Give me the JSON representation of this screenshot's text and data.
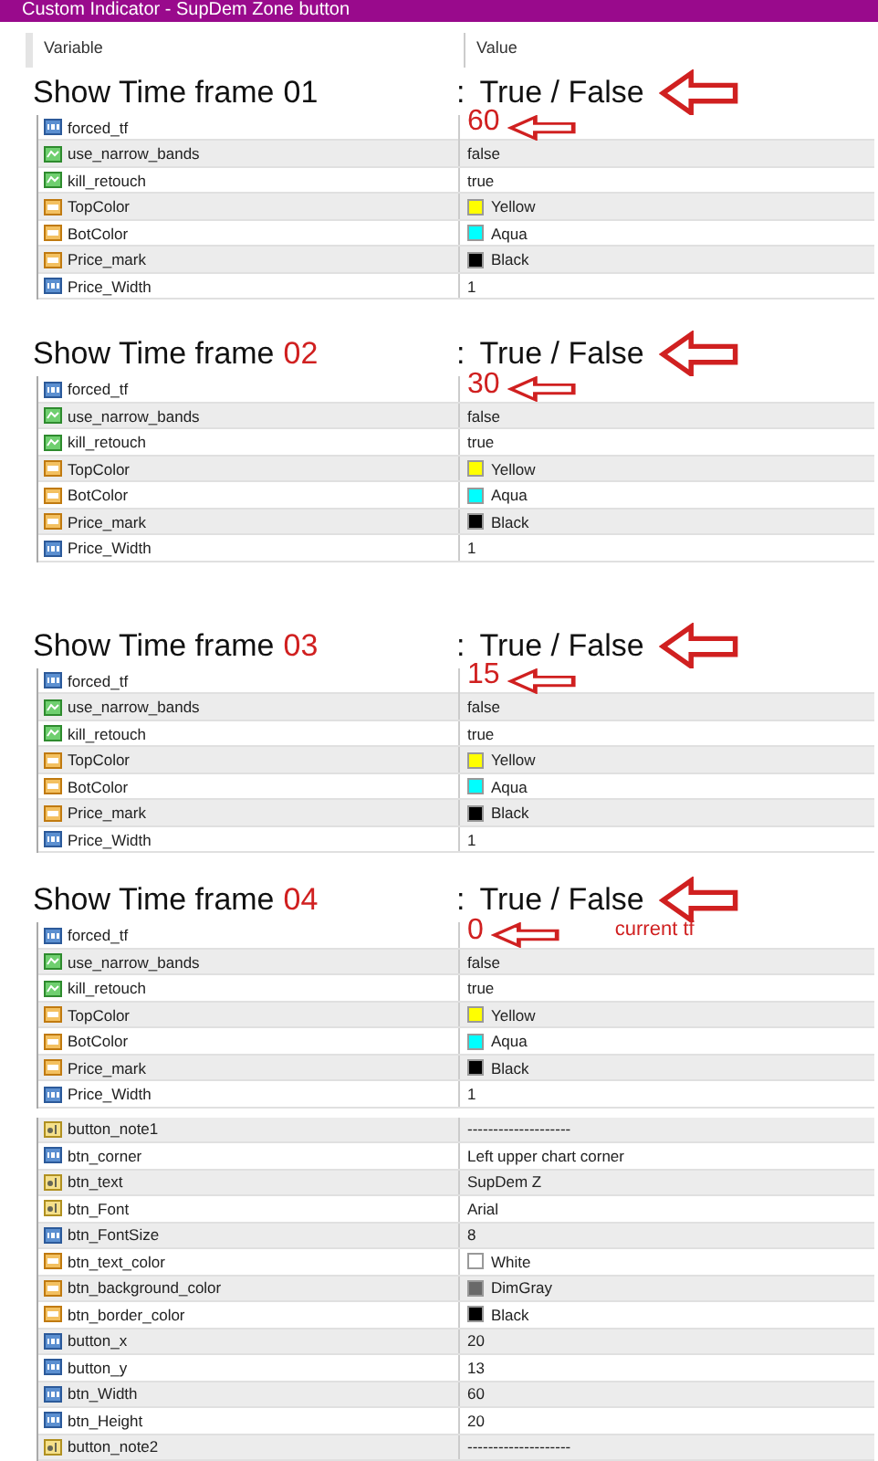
{
  "window": {
    "title": "Custom Indicator - SupDem Zone button"
  },
  "table": {
    "columns": [
      "Variable",
      "Value"
    ]
  },
  "sections": [
    {
      "heading": {
        "label": "Show Time frame",
        "number": "01",
        "number_red": false,
        "separator": ":",
        "value": "True / False"
      },
      "rows": [
        {
          "kind": "int",
          "name": "forced_tf",
          "value": "60",
          "annotated": true
        },
        {
          "kind": "bool",
          "name": "use_narrow_bands",
          "value": "false"
        },
        {
          "kind": "bool",
          "name": "kill_retouch",
          "value": "true"
        },
        {
          "kind": "color",
          "name": "TopColor",
          "value": "Yellow",
          "color": "#ffff00"
        },
        {
          "kind": "color",
          "name": "BotColor",
          "value": "Aqua",
          "color": "#00ffff"
        },
        {
          "kind": "color",
          "name": "Price_mark",
          "value": "Black",
          "color": "#000000"
        },
        {
          "kind": "int",
          "name": "Price_Width",
          "value": "1"
        }
      ]
    },
    {
      "heading": {
        "label": "Show Time frame",
        "number": "02",
        "number_red": true,
        "separator": ":",
        "value": "True / False"
      },
      "rows": [
        {
          "kind": "int",
          "name": "forced_tf",
          "value": "30",
          "annotated": true
        },
        {
          "kind": "bool",
          "name": "use_narrow_bands",
          "value": "false"
        },
        {
          "kind": "bool",
          "name": "kill_retouch",
          "value": "true"
        },
        {
          "kind": "color",
          "name": "TopColor",
          "value": "Yellow",
          "color": "#ffff00"
        },
        {
          "kind": "color",
          "name": "BotColor",
          "value": "Aqua",
          "color": "#00ffff"
        },
        {
          "kind": "color",
          "name": "Price_mark",
          "value": "Black",
          "color": "#000000"
        },
        {
          "kind": "int",
          "name": "Price_Width",
          "value": "1"
        }
      ]
    },
    {
      "heading": {
        "label": "Show Time frame",
        "number": "03",
        "number_red": true,
        "separator": ":",
        "value": "True / False"
      },
      "rows": [
        {
          "kind": "int",
          "name": "forced_tf",
          "value": "15",
          "annotated": true
        },
        {
          "kind": "bool",
          "name": "use_narrow_bands",
          "value": "false"
        },
        {
          "kind": "bool",
          "name": "kill_retouch",
          "value": "true"
        },
        {
          "kind": "color",
          "name": "TopColor",
          "value": "Yellow",
          "color": "#ffff00"
        },
        {
          "kind": "color",
          "name": "BotColor",
          "value": "Aqua",
          "color": "#00ffff"
        },
        {
          "kind": "color",
          "name": "Price_mark",
          "value": "Black",
          "color": "#000000"
        },
        {
          "kind": "int",
          "name": "Price_Width",
          "value": "1"
        }
      ]
    },
    {
      "heading": {
        "label": "Show Time frame",
        "number": "04",
        "number_red": true,
        "separator": ":",
        "value": "True / False"
      },
      "rows": [
        {
          "kind": "int",
          "name": "forced_tf",
          "value": "0",
          "annotated": true,
          "note": "current tf"
        },
        {
          "kind": "bool",
          "name": "use_narrow_bands",
          "value": "false"
        },
        {
          "kind": "bool",
          "name": "kill_retouch",
          "value": "true"
        },
        {
          "kind": "color",
          "name": "TopColor",
          "value": "Yellow",
          "color": "#ffff00"
        },
        {
          "kind": "color",
          "name": "BotColor",
          "value": "Aqua",
          "color": "#00ffff"
        },
        {
          "kind": "color",
          "name": "Price_mark",
          "value": "Black",
          "color": "#000000"
        },
        {
          "kind": "int",
          "name": "Price_Width",
          "value": "1"
        }
      ]
    }
  ],
  "button_rows": [
    {
      "kind": "string",
      "name": "button_note1",
      "value": "--------------------"
    },
    {
      "kind": "int",
      "name": "btn_corner",
      "value": "Left upper chart corner"
    },
    {
      "kind": "string",
      "name": "btn_text",
      "value": "SupDem Z"
    },
    {
      "kind": "string",
      "name": "btn_Font",
      "value": "Arial"
    },
    {
      "kind": "int",
      "name": "btn_FontSize",
      "value": "8"
    },
    {
      "kind": "color",
      "name": "btn_text_color",
      "value": "White",
      "color": "#ffffff"
    },
    {
      "kind": "color",
      "name": "btn_background_color",
      "value": "DimGray",
      "color": "#696969"
    },
    {
      "kind": "color",
      "name": "btn_border_color",
      "value": "Black",
      "color": "#000000"
    },
    {
      "kind": "int",
      "name": "button_x",
      "value": "20"
    },
    {
      "kind": "int",
      "name": "button_y",
      "value": "13"
    },
    {
      "kind": "int",
      "name": "btn_Width",
      "value": "60"
    },
    {
      "kind": "int",
      "name": "btn_Height",
      "value": "20"
    },
    {
      "kind": "string",
      "name": "button_note2",
      "value": "--------------------"
    }
  ]
}
